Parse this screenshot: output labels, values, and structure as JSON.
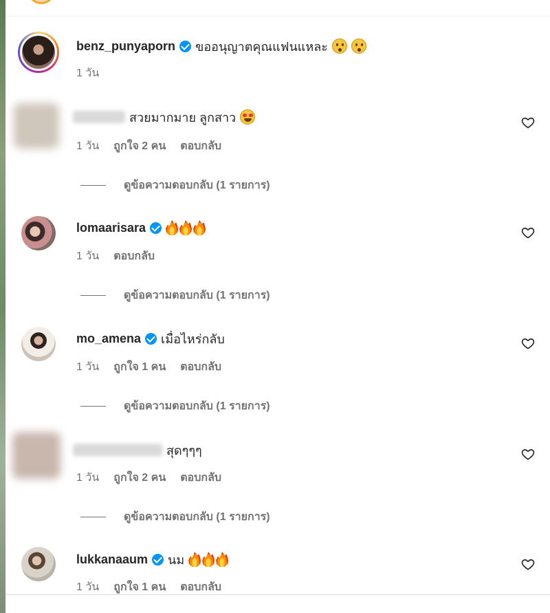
{
  "comments": [
    {
      "username": "benz_punyaporn",
      "verified": true,
      "text": "ขออนุญาตคุณแฟนแหละ",
      "emoji": [
        "face-icon",
        "face-icon"
      ],
      "time": "1 วัน"
    },
    {
      "username": "",
      "blurred": true,
      "text": "สวยมากมาย ลูกสาว",
      "emoji": [
        "heart-eyes-icon"
      ],
      "time": "1 วัน",
      "likes": "ถูกใจ 2 คน",
      "reply": "ตอบกลับ",
      "view_replies": "ดูข้อความตอบกลับ (1 รายการ)"
    },
    {
      "username": "lomaarisara",
      "verified": true,
      "text": "",
      "emoji": [
        "fire-icon",
        "fire-icon",
        "fire-icon"
      ],
      "time": "1 วัน",
      "reply": "ตอบกลับ",
      "view_replies": "ดูข้อความตอบกลับ (1 รายการ)"
    },
    {
      "username": "mo_amena",
      "verified": true,
      "text": "เมื่อไหร่กลับ",
      "time": "1 วัน",
      "likes": "ถูกใจ 1 คน",
      "reply": "ตอบกลับ",
      "view_replies": "ดูข้อความตอบกลับ (1 รายการ)"
    },
    {
      "username": "",
      "blurred": true,
      "text": "สุดๆๆๆ",
      "time": "1 วัน",
      "likes": "ถูกใจ 2 คน",
      "reply": "ตอบกลับ",
      "view_replies": "ดูข้อความตอบกลับ (1 รายการ)"
    },
    {
      "username": "lukkanaaum",
      "verified": true,
      "text": "นม",
      "emoji": [
        "fire-icon",
        "fire-icon",
        "fire-icon"
      ],
      "time": "1 วัน",
      "likes": "ถูกใจ 1 คน",
      "reply": "ตอบกลับ"
    }
  ],
  "colors": {
    "verified_badge": "#0095f6",
    "secondary_text": "#737373",
    "primary_text": "#262626"
  }
}
